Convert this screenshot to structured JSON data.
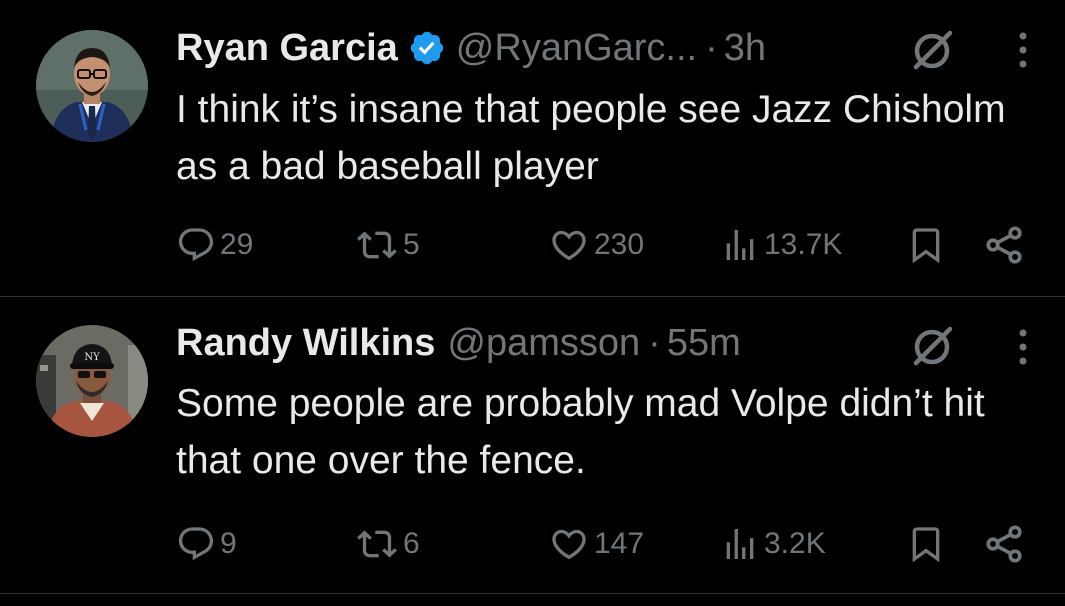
{
  "tweets": [
    {
      "name": "Ryan Garcia",
      "verified": true,
      "handle": "@RyanGarc...",
      "dot": "·",
      "time": "3h",
      "text": "I think it’s insane that people see Jazz Chisholm as a bad baseball player",
      "replies": "29",
      "reposts": "5",
      "likes": "230",
      "views": "13.7K"
    },
    {
      "name": "Randy Wilkins",
      "verified": false,
      "handle": "@pamsson",
      "dot": "·",
      "time": "55m",
      "text": "Some people are probably mad Volpe didn’t hit that one over the fence.",
      "replies": "9",
      "reposts": "6",
      "likes": "147",
      "views": "3.2K"
    }
  ],
  "icons": {
    "reply": "speech-bubble-icon",
    "repost": "repost-arrows-icon",
    "like": "heart-icon",
    "views": "bar-chart-icon",
    "bookmark": "bookmark-icon",
    "share": "share-icon",
    "grok": "grok-slash-icon",
    "more": "vertical-dots-icon",
    "verified": "blue-check-badge-icon"
  },
  "colors": {
    "background": "#000000",
    "primary_text": "#e7e9ea",
    "secondary_text": "#71767b",
    "verified_blue": "#1d9bf0",
    "divider": "#2f3336"
  }
}
